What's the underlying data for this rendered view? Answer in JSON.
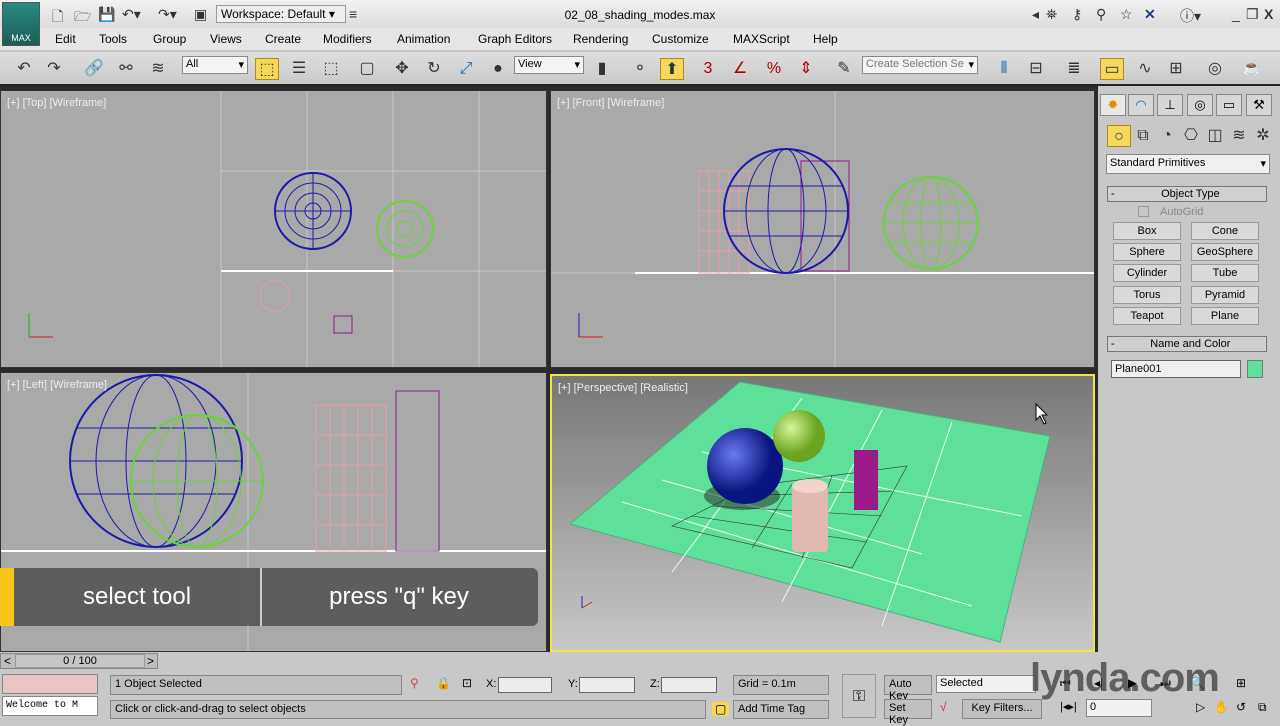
{
  "app": {
    "logo_label": "MAX",
    "workspace": "Workspace: Default",
    "file_title": "02_08_shading_modes.max"
  },
  "menu": [
    "Edit",
    "Tools",
    "Group",
    "Views",
    "Create",
    "Modifiers",
    "Animation",
    "Graph Editors",
    "Rendering",
    "Customize",
    "MAXScript",
    "Help"
  ],
  "toolbar": {
    "selection_filter": "All",
    "ref_coord": "View",
    "selection_set_placeholder": "Create Selection Se"
  },
  "viewports": {
    "top": "[+] [Top] [Wireframe]",
    "front": "[+] [Front] [Wireframe]",
    "left": "[+] [Left] [Wireframe]",
    "perspective": "[+] [Perspective] [Realistic]"
  },
  "command_panel": {
    "category": "Standard Primitives",
    "object_type_title": "Object Type",
    "autogrid": "AutoGrid",
    "buttons": [
      "Box",
      "Cone",
      "Sphere",
      "GeoSphere",
      "Cylinder",
      "Tube",
      "Torus",
      "Pyramid",
      "Teapot",
      "Plane"
    ],
    "name_color_title": "Name and Color",
    "object_name": "Plane001",
    "object_color": "#5ee09a"
  },
  "caption": {
    "left": "select tool",
    "right": "press \"q\" key"
  },
  "timeline": {
    "frame": "0 / 100"
  },
  "status": {
    "listener": "Welcome to M",
    "selection": "1 Object Selected",
    "prompt": "Click or click-and-drag to select objects",
    "x_label": "X:",
    "y_label": "Y:",
    "z_label": "Z:",
    "grid": "Grid = 0.1m",
    "add_time_tag": "Add Time Tag",
    "auto_key": "Auto Key",
    "set_key": "Set Key",
    "key_mode": "Selected",
    "key_filters": "Key Filters...",
    "current_frame": "0"
  },
  "watermark": "lynda.com"
}
